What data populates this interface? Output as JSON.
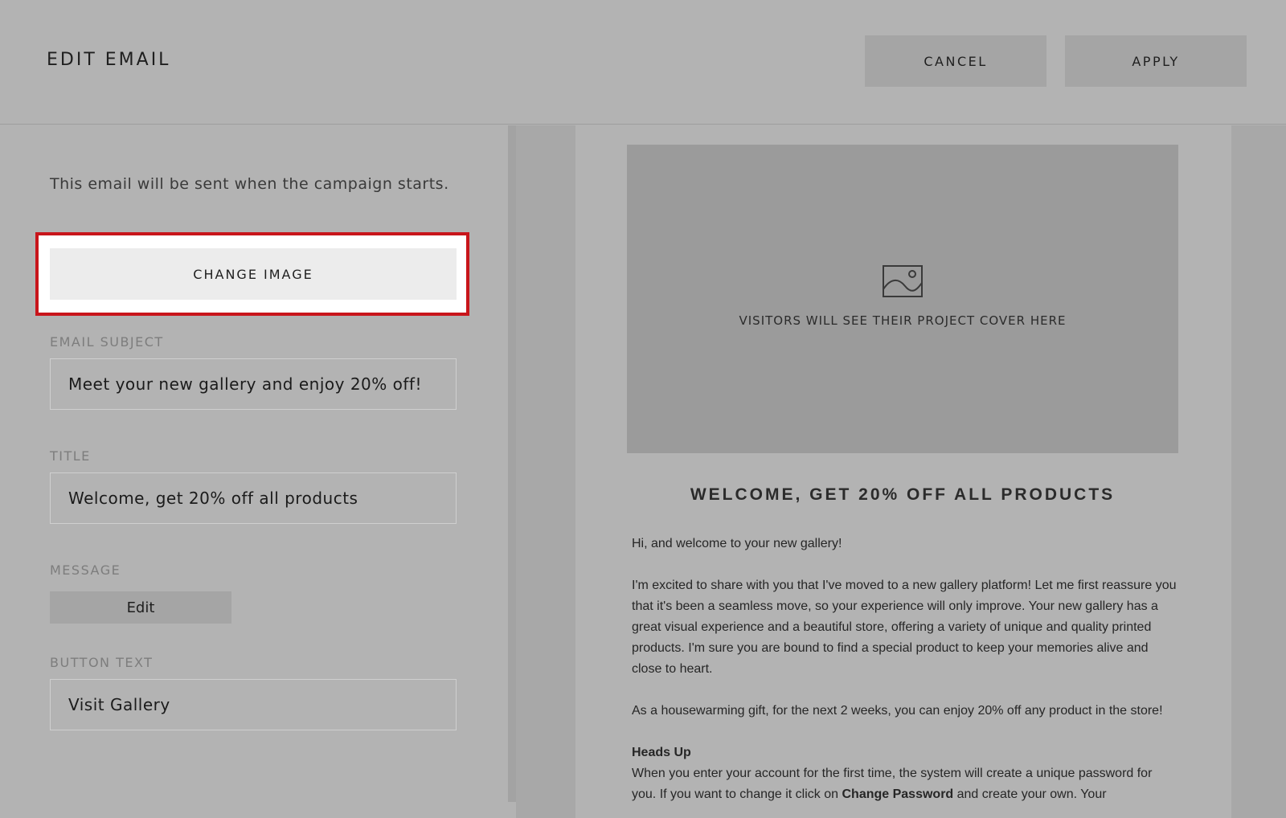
{
  "header": {
    "title": "EDIT EMAIL",
    "cancel_label": "CANCEL",
    "apply_label": "APPLY"
  },
  "form": {
    "intro": "This email will be sent when the campaign starts.",
    "change_image_label": "CHANGE IMAGE",
    "email_subject_label": "EMAIL SUBJECT",
    "email_subject_value": "Meet your new gallery and enjoy 20% off!",
    "title_label": "TITLE",
    "title_value": "Welcome, get 20% off all products",
    "message_label": "MESSAGE",
    "message_edit_label": "Edit",
    "button_text_label": "BUTTON TEXT",
    "button_text_value": "Visit Gallery"
  },
  "preview": {
    "cover_caption": "VISITORS WILL SEE THEIR PROJECT COVER HERE",
    "title": "WELCOME, GET 20% OFF ALL PRODUCTS",
    "greeting": "Hi, and welcome to your new gallery!",
    "paragraph_1": "I'm excited to share with you that I've moved to a new gallery platform! Let me first reassure you that it's been a seamless move, so your experience will only improve. Your new gallery has a great visual experience and a beautiful store, offering a variety of unique and quality printed products. I'm sure you are bound to find a special product to keep your memories alive and close to heart.",
    "paragraph_2": "As a housewarming gift, for the next 2 weeks, you can enjoy 20% off any product in the store!",
    "heads_up": "Heads Up",
    "paragraph_3_start": "When you enter your account for the first time, the system will create a unique password for you. If you want to change it click on ",
    "paragraph_3_bold": "Change Password",
    "paragraph_3_end": " and create your own. Your"
  },
  "colors": {
    "highlight": "#c8151b",
    "background": "#b3b3b3"
  },
  "icons": {
    "cover_placeholder": "image-placeholder-icon"
  }
}
